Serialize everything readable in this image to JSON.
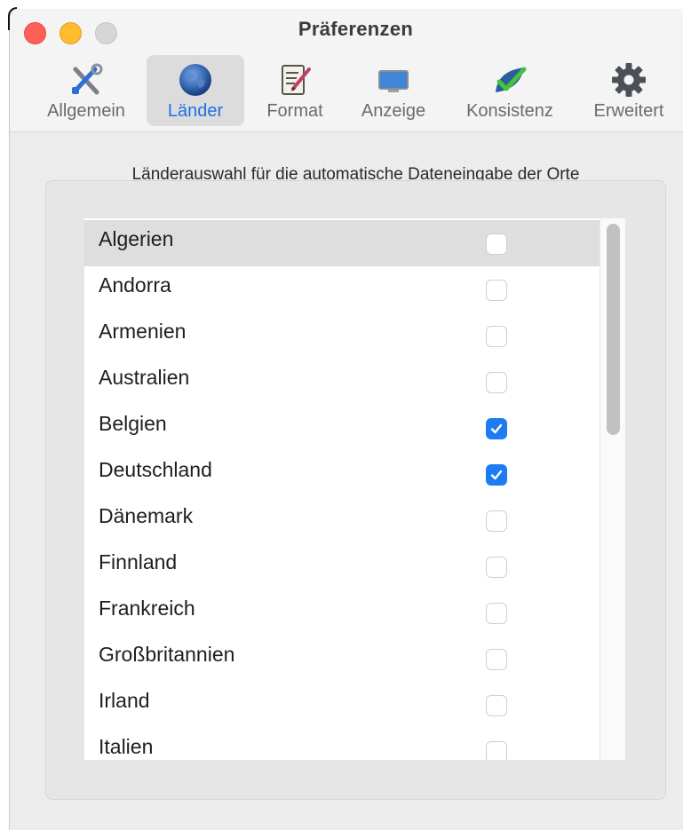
{
  "window": {
    "title": "Präferenzen"
  },
  "toolbar": {
    "items": [
      {
        "label": "Allgemein",
        "icon": "tools-icon"
      },
      {
        "label": "Länder",
        "icon": "globe-icon",
        "active": true
      },
      {
        "label": "Format",
        "icon": "document-edit-icon"
      },
      {
        "label": "Anzeige",
        "icon": "display-icon"
      },
      {
        "label": "Konsistenz",
        "icon": "checkmark-leaf-icon"
      },
      {
        "label": "Erweitert",
        "icon": "gear-icon"
      }
    ]
  },
  "section": {
    "title": "Länderauswahl für die automatische Dateneingabe der Orte"
  },
  "countries": [
    {
      "name": "Algerien",
      "checked": false,
      "selected": true
    },
    {
      "name": "Andorra",
      "checked": false
    },
    {
      "name": "Armenien",
      "checked": false
    },
    {
      "name": "Australien",
      "checked": false
    },
    {
      "name": "Belgien",
      "checked": true
    },
    {
      "name": "Deutschland",
      "checked": true
    },
    {
      "name": "Dänemark",
      "checked": false
    },
    {
      "name": "Finnland",
      "checked": false
    },
    {
      "name": "Frankreich",
      "checked": false
    },
    {
      "name": "Großbritannien",
      "checked": false
    },
    {
      "name": "Irland",
      "checked": false
    },
    {
      "name": "Italien",
      "checked": false
    }
  ],
  "colors": {
    "accent": "#1d7cf2",
    "close": "#fe5f57",
    "minimize": "#febc2e",
    "zoom_disabled": "#d6d6d6"
  }
}
